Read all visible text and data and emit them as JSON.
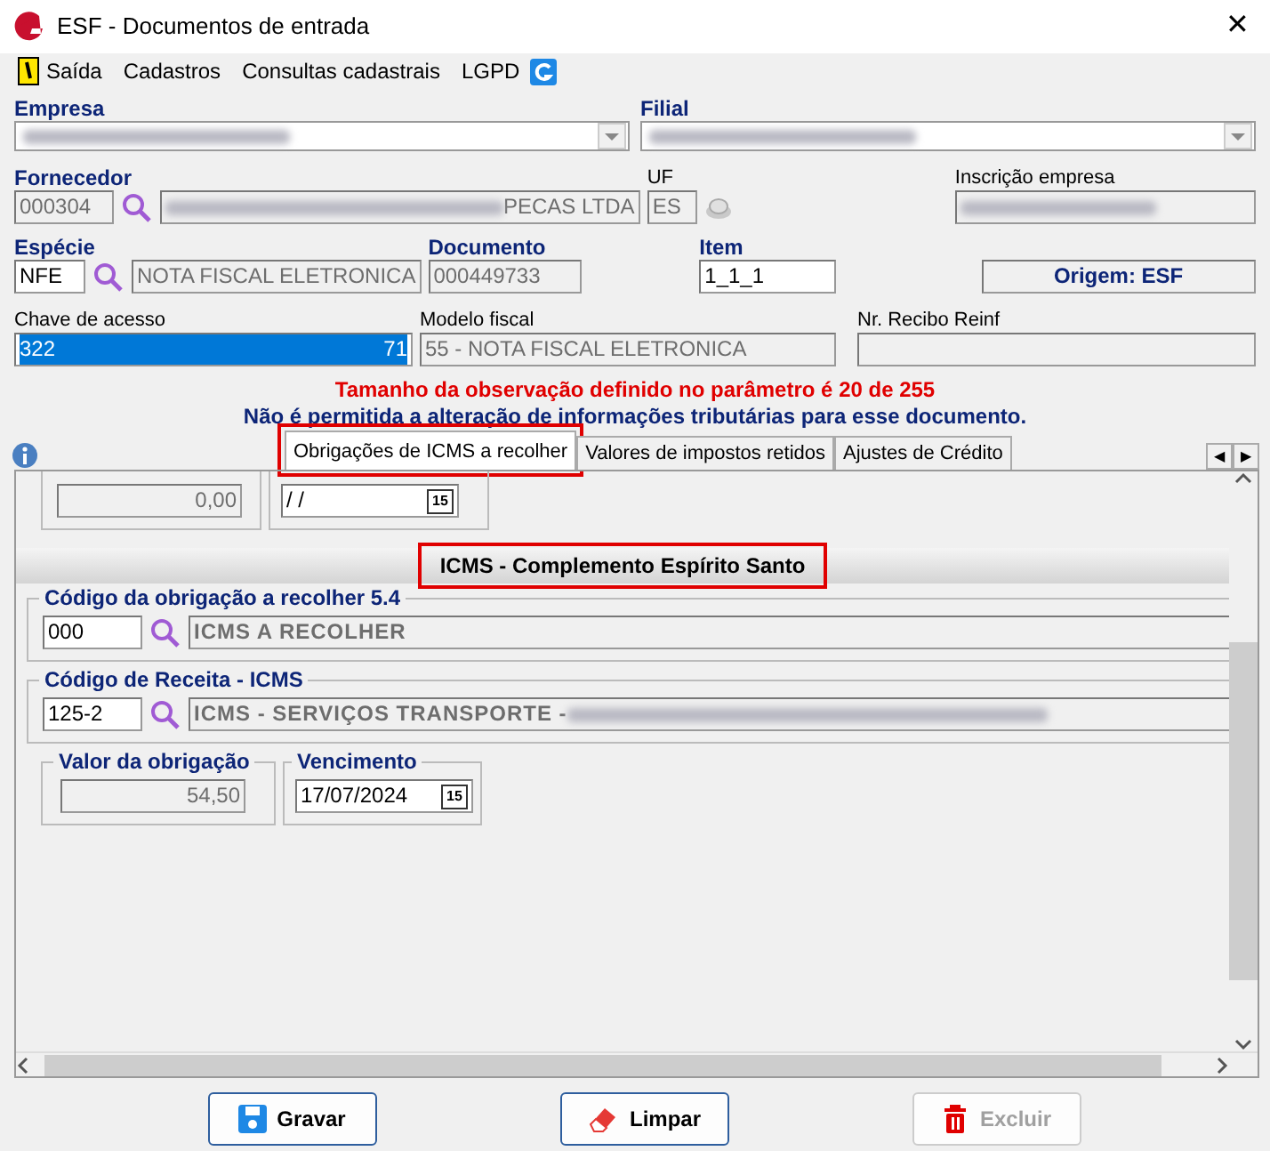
{
  "window": {
    "title": "ESF - Documentos de entrada",
    "close": "✕"
  },
  "menu": [
    {
      "label": "Saída",
      "kind": "exit"
    },
    {
      "label": "Cadastros",
      "kind": "plain"
    },
    {
      "label": "Consultas cadastrais",
      "kind": "plain"
    },
    {
      "label": "LGPD",
      "kind": "plain"
    },
    {
      "kind": "logo"
    }
  ],
  "empresa": {
    "label": "Empresa"
  },
  "filial": {
    "label": "Filial"
  },
  "fornecedor": {
    "label": "Fornecedor",
    "code": "000304",
    "name_visible": "PECAS LTDA"
  },
  "uf": {
    "label": "UF",
    "value": "ES"
  },
  "inscricao": {
    "label": "Inscrição empresa"
  },
  "especie": {
    "label": "Espécie",
    "code": "NFE",
    "name": "NOTA FISCAL ELETRONICA"
  },
  "documento": {
    "label": "Documento",
    "value": "000449733"
  },
  "item": {
    "label": "Item",
    "value": "1_1_1"
  },
  "origem": "Origem: ESF",
  "chave": {
    "label": "Chave de acesso",
    "start": "322",
    "end": "71"
  },
  "modelo": {
    "label": "Modelo fiscal",
    "value": "55 - NOTA FISCAL ELETRONICA"
  },
  "recibo": {
    "label": "Nr. Recibo Reinf"
  },
  "messages": [
    {
      "text": "Tamanho da observação definido no parâmetro é 20 de 255",
      "kind": "warning"
    },
    {
      "text": "Não é permitida a alteração de informações tributárias para esse documento.",
      "kind": "info"
    }
  ],
  "tabs": [
    {
      "label": "Obrigações de ICMS a recolher",
      "selected": true
    },
    {
      "label": "Valores de impostos retidos",
      "selected": false
    },
    {
      "label": "Ajustes de Crédito",
      "selected": false
    }
  ],
  "tab_scroll": [
    "◀",
    "▶"
  ],
  "panel": {
    "top_value": "0,00",
    "top_date": " / /",
    "top_calendar": "15",
    "section": "ICMS - Complemento Espírito Santo",
    "obrigacao": {
      "label": "Código da obrigação a recolher 5.4",
      "code": "000",
      "desc": "ICMS A RECOLHER"
    },
    "receita": {
      "label": "Código de Receita - ICMS",
      "code": "125-2",
      "desc": "ICMS - SERVIÇOS TRANSPORTE - "
    },
    "valor": {
      "label": "Valor da obrigação",
      "value": "54,50"
    },
    "vencimento": {
      "label": "Vencimento",
      "value": "17/07/2024",
      "calendar": "15"
    }
  },
  "buttons": [
    {
      "label": "Gravar",
      "kind": "save",
      "disabled": false
    },
    {
      "label": "Limpar",
      "kind": "clear",
      "disabled": false
    },
    {
      "label": "Excluir",
      "kind": "delete",
      "disabled": true
    }
  ]
}
